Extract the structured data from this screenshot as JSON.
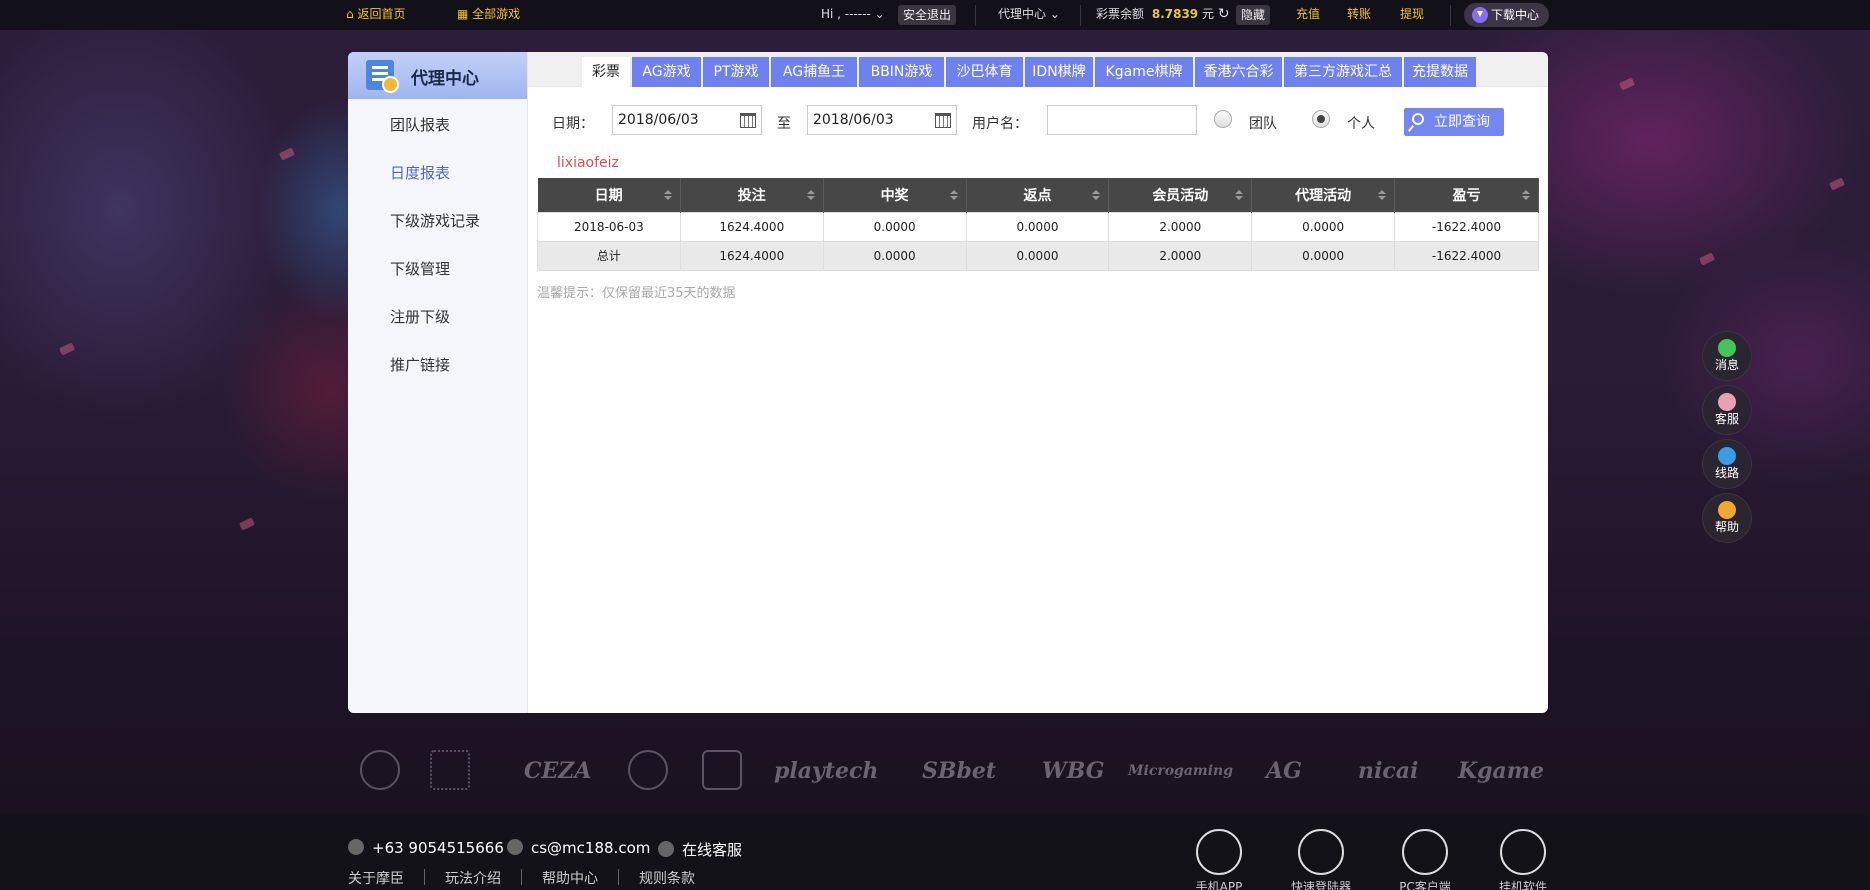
{
  "topbar": {
    "home": "返回首页",
    "all_games": "全部游戏",
    "greeting": "Hi , ------",
    "logout": "安全退出",
    "agent_center": "代理中心",
    "balance_label": "彩票余额",
    "balance_value": "8.7839",
    "balance_unit": "元",
    "hide": "隐藏",
    "deposit": "充值",
    "transfer": "转账",
    "withdraw": "提现",
    "download_center": "下载中心"
  },
  "sidebar": {
    "title": "代理中心",
    "items": [
      {
        "label": "团队报表",
        "active": false
      },
      {
        "label": "日度报表",
        "active": true
      },
      {
        "label": "下级游戏记录",
        "active": false
      },
      {
        "label": "下级管理",
        "active": false
      },
      {
        "label": "注册下级",
        "active": false
      },
      {
        "label": "推广链接",
        "active": false
      }
    ]
  },
  "tabs": [
    "彩票",
    "AG游戏",
    "PT游戏",
    "AG捕鱼王",
    "BBIN游戏",
    "沙巴体育",
    "IDN棋牌",
    "Kgame棋牌",
    "香港六合彩",
    "第三方游戏汇总",
    "充提数据"
  ],
  "active_tab": "彩票",
  "search": {
    "date_label": "日期：",
    "date_from": "2018/06/03",
    "to_label": "至",
    "date_to": "2018/06/03",
    "username_label": "用户名：",
    "username_value": "",
    "radio_team": "团队",
    "radio_personal": "个人",
    "selected_radio": "个人",
    "query_button": "立即查询"
  },
  "username_display": "lixiaofeiz",
  "table": {
    "columns": [
      "日期",
      "投注",
      "中奖",
      "返点",
      "会员活动",
      "代理活动",
      "盈亏"
    ],
    "rows": [
      [
        "2018-06-03",
        "1624.4000",
        "0.0000",
        "0.0000",
        "2.0000",
        "0.0000",
        "-1622.4000"
      ]
    ],
    "total": [
      "总计",
      "1624.4000",
      "0.0000",
      "0.0000",
      "2.0000",
      "0.0000",
      "-1622.4000"
    ]
  },
  "tip": "温馨提示：仅保留最近35天的数据",
  "float_buttons": [
    {
      "label": "消息",
      "icon": "chat-icon",
      "color": "#45c45a"
    },
    {
      "label": "客服",
      "icon": "agent-icon",
      "color": "#e9a0b0"
    },
    {
      "label": "线路",
      "icon": "route-icon",
      "color": "#3a9be8"
    },
    {
      "label": "帮助",
      "icon": "help-icon",
      "color": "#f0a830"
    }
  ],
  "partners": [
    "CEZA",
    "playtech",
    "SBbet",
    "WBG",
    "Microgaming",
    "AG",
    "nicai",
    "Kgame"
  ],
  "footer": {
    "phone": "+63 9054515666",
    "email": "cs@mc188.com",
    "online_service": "在线客服",
    "links": [
      "关于摩臣",
      "玩法介绍",
      "帮助中心",
      "规则条款"
    ],
    "apps": [
      "手机APP",
      "快速登陆器",
      "PC客户端",
      "挂机软件"
    ]
  },
  "colors": {
    "tab_accent": "#6f81ee",
    "balance": "#e8c740",
    "username": "#e94b4b"
  }
}
